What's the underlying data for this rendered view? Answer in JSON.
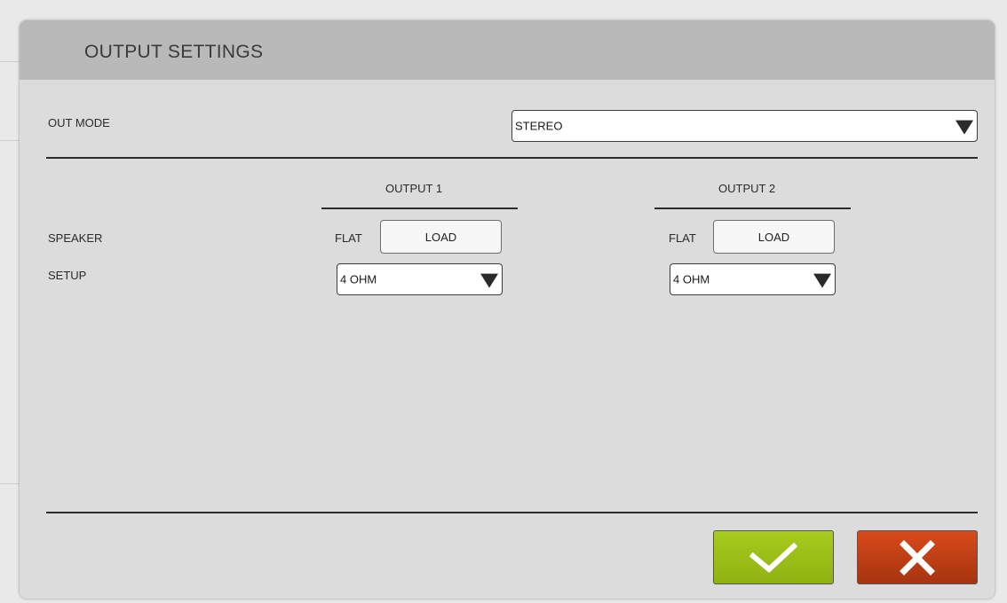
{
  "dialog": {
    "title": "OUTPUT SETTINGS"
  },
  "out_mode": {
    "label": "OUT MODE",
    "value": "STEREO"
  },
  "row_labels": {
    "speaker": "SPEAKER",
    "setup": "SETUP"
  },
  "outputs": [
    {
      "header": "OUTPUT 1",
      "flat_label": "FLAT",
      "load_label": "LOAD",
      "impedance": "4 OHM"
    },
    {
      "header": "OUTPUT 2",
      "flat_label": "FLAT",
      "load_label": "LOAD",
      "impedance": "4 OHM"
    }
  ],
  "buttons": {
    "confirm_icon": "checkmark-icon",
    "cancel_icon": "close-icon"
  },
  "colors": {
    "confirm": "#9dbf16",
    "cancel": "#c8411a",
    "header": "#b9b9b9"
  }
}
